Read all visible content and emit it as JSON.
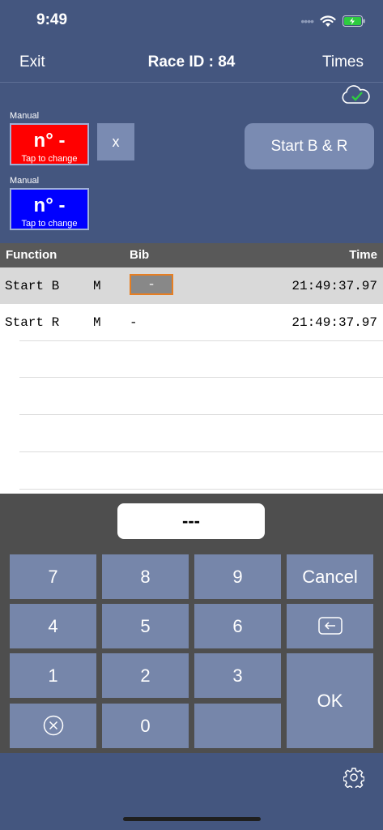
{
  "status": {
    "time": "9:49",
    "dots": "••••"
  },
  "nav": {
    "exit": "Exit",
    "title": "Race ID : 84",
    "times": "Times"
  },
  "manual": [
    {
      "label": "Manual",
      "number": "n° -",
      "hint": "Tap to change",
      "color": "#ff0000"
    },
    {
      "label": "Manual",
      "number": "n° -",
      "hint": "Tap to change",
      "color": "#0000ff"
    }
  ],
  "x_button": "x",
  "start_button": "Start B & R",
  "table": {
    "headers": {
      "function": "Function",
      "bib": "Bib",
      "time": "Time"
    },
    "rows": [
      {
        "function": "Start B",
        "mode": "M",
        "bib": "-",
        "time": "21:49:37.97"
      },
      {
        "function": "Start R",
        "mode": "M",
        "bib": "-",
        "time": "21:49:37.97"
      }
    ]
  },
  "display": "---",
  "keys": {
    "k7": "7",
    "k8": "8",
    "k9": "9",
    "cancel": "Cancel",
    "k4": "4",
    "k5": "5",
    "k6": "6",
    "k1": "1",
    "k2": "2",
    "k3": "3",
    "k0": "0",
    "ok": "OK"
  },
  "colors": {
    "accent": "#7686aa",
    "selected_bib_border": "#e67e22",
    "cloud_check": "#2ecc40"
  }
}
